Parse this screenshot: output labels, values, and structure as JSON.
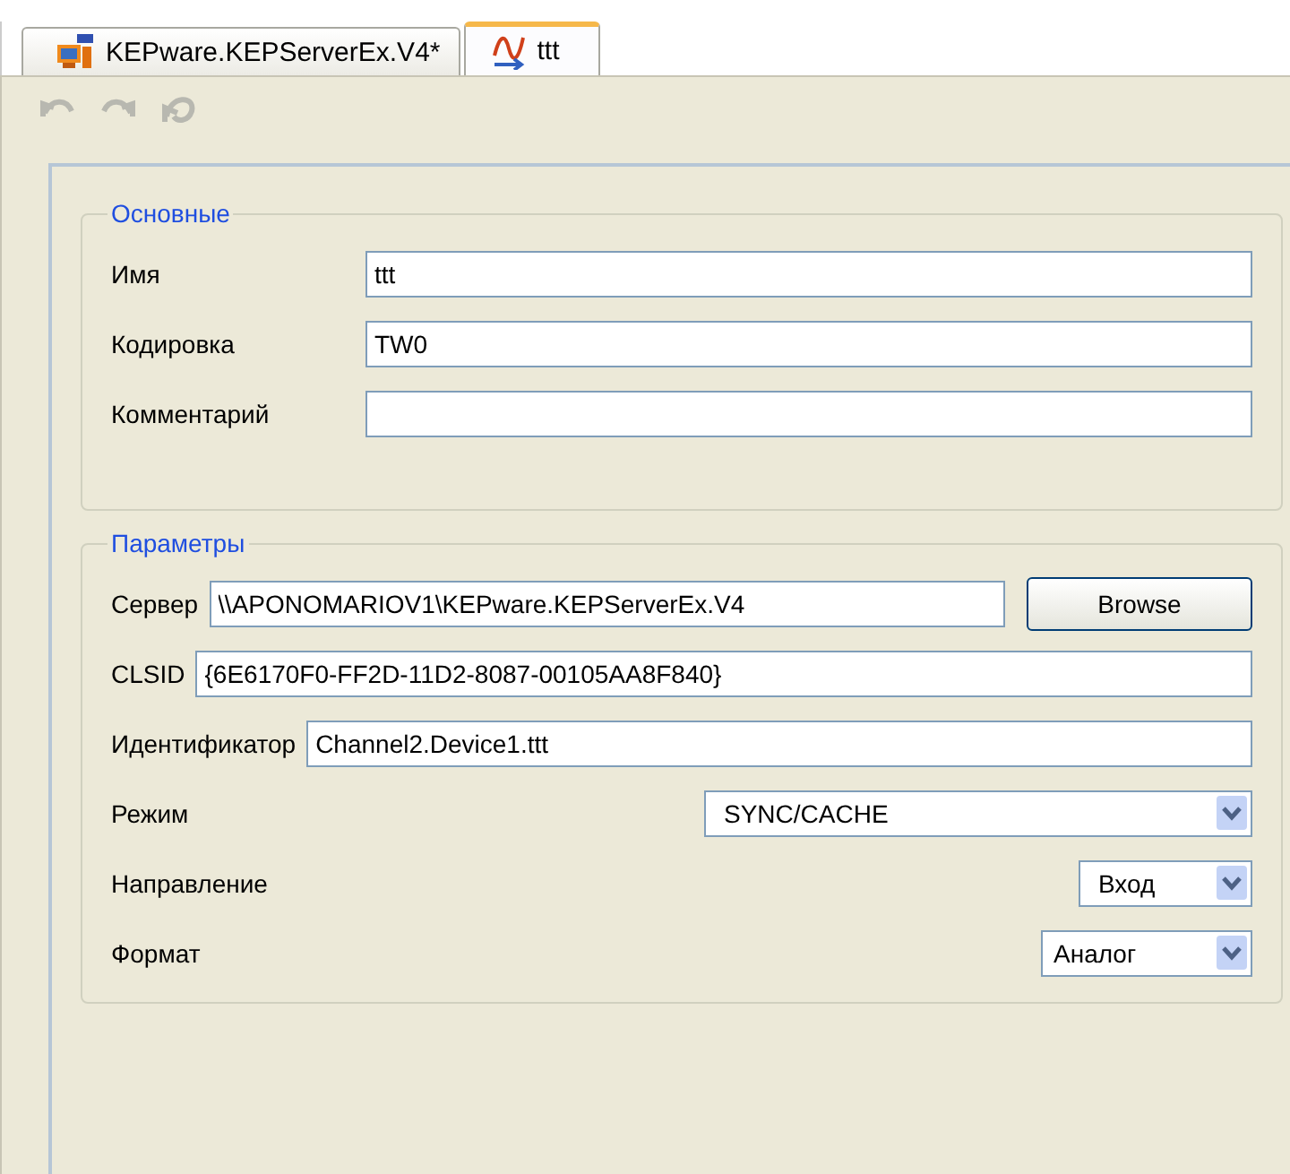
{
  "tabs": [
    {
      "label": "KEPware.KEPServerEx.V4*",
      "kind": "server",
      "selected": false
    },
    {
      "label": "ttt",
      "kind": "signal",
      "selected": true
    }
  ],
  "toolbar": [
    {
      "kind": "undo",
      "disabled": true
    },
    {
      "kind": "redo",
      "disabled": true
    },
    {
      "kind": "reset",
      "disabled": true
    }
  ],
  "groups": [
    {
      "title": "Основные",
      "fields": [
        {
          "label": "Имя",
          "kind": "text",
          "value": "ttt"
        },
        {
          "label": "Кодировка",
          "kind": "text",
          "value": "TW0"
        },
        {
          "label": "Комментарий",
          "kind": "text"
        }
      ]
    },
    {
      "title": "Параметры",
      "fields": [
        {
          "label": "Сервер",
          "kind": "text",
          "value": "\\\\APONOMARIOV1\\KEPware.KEPServerEx.V4",
          "button": "Browse"
        },
        {
          "label": "CLSID",
          "kind": "text",
          "value": "{6E6170F0-FF2D-11D2-8087-00105AA8F840}"
        },
        {
          "label": "Идентификатор",
          "kind": "text",
          "value": "Channel2.Device1.ttt"
        },
        {
          "label": "Режим",
          "kind": "select",
          "value": "SYNC/CACHE"
        },
        {
          "label": "Направление",
          "kind": "select",
          "value": "Вход"
        },
        {
          "label": "Формат",
          "kind": "select",
          "value": "Аналог"
        }
      ]
    }
  ]
}
